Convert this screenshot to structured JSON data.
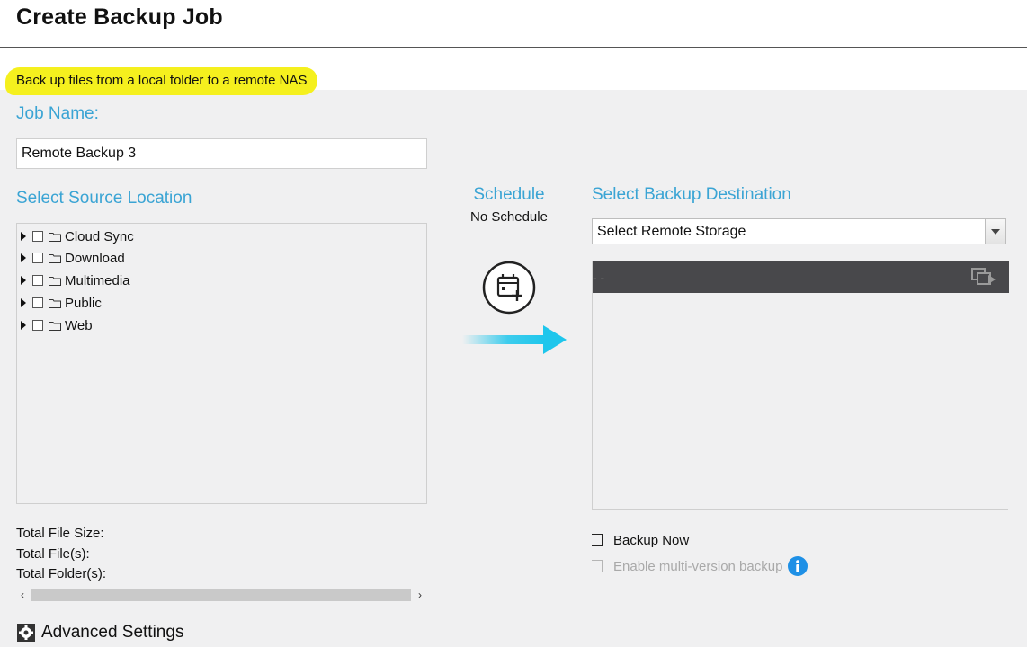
{
  "header": {
    "title": "Create Backup Job"
  },
  "subtitle": "Back up files from a local folder to a remote NAS",
  "job_name": {
    "label": "Job Name:",
    "value": "Remote Backup 3"
  },
  "source": {
    "label": "Select Source Location",
    "folders": [
      "Cloud Sync",
      "Download",
      "Multimedia",
      "Public",
      "Web"
    ]
  },
  "totals": {
    "file_size": "Total File Size:",
    "files": "Total File(s):",
    "folders": "Total Folder(s):"
  },
  "advanced_settings": "Advanced Settings",
  "schedule": {
    "label": "Schedule",
    "value": "No Schedule"
  },
  "destination": {
    "label": "Select Backup Destination",
    "select_value": "Select Remote Storage",
    "path": "- -"
  },
  "options": {
    "backup_now": "Backup Now",
    "multi_version": "Enable multi-version backup"
  },
  "icons": [
    "folder-icon",
    "calendar-add-icon",
    "arrow-right-icon",
    "remote-nav-icon",
    "gear-icon",
    "info-icon"
  ],
  "colors": {
    "accent": "#3aa4d4",
    "highlight": "#f5f01e",
    "bar": "#48484b",
    "arrow": "#1ec6ec",
    "info": "#1e90e6"
  }
}
